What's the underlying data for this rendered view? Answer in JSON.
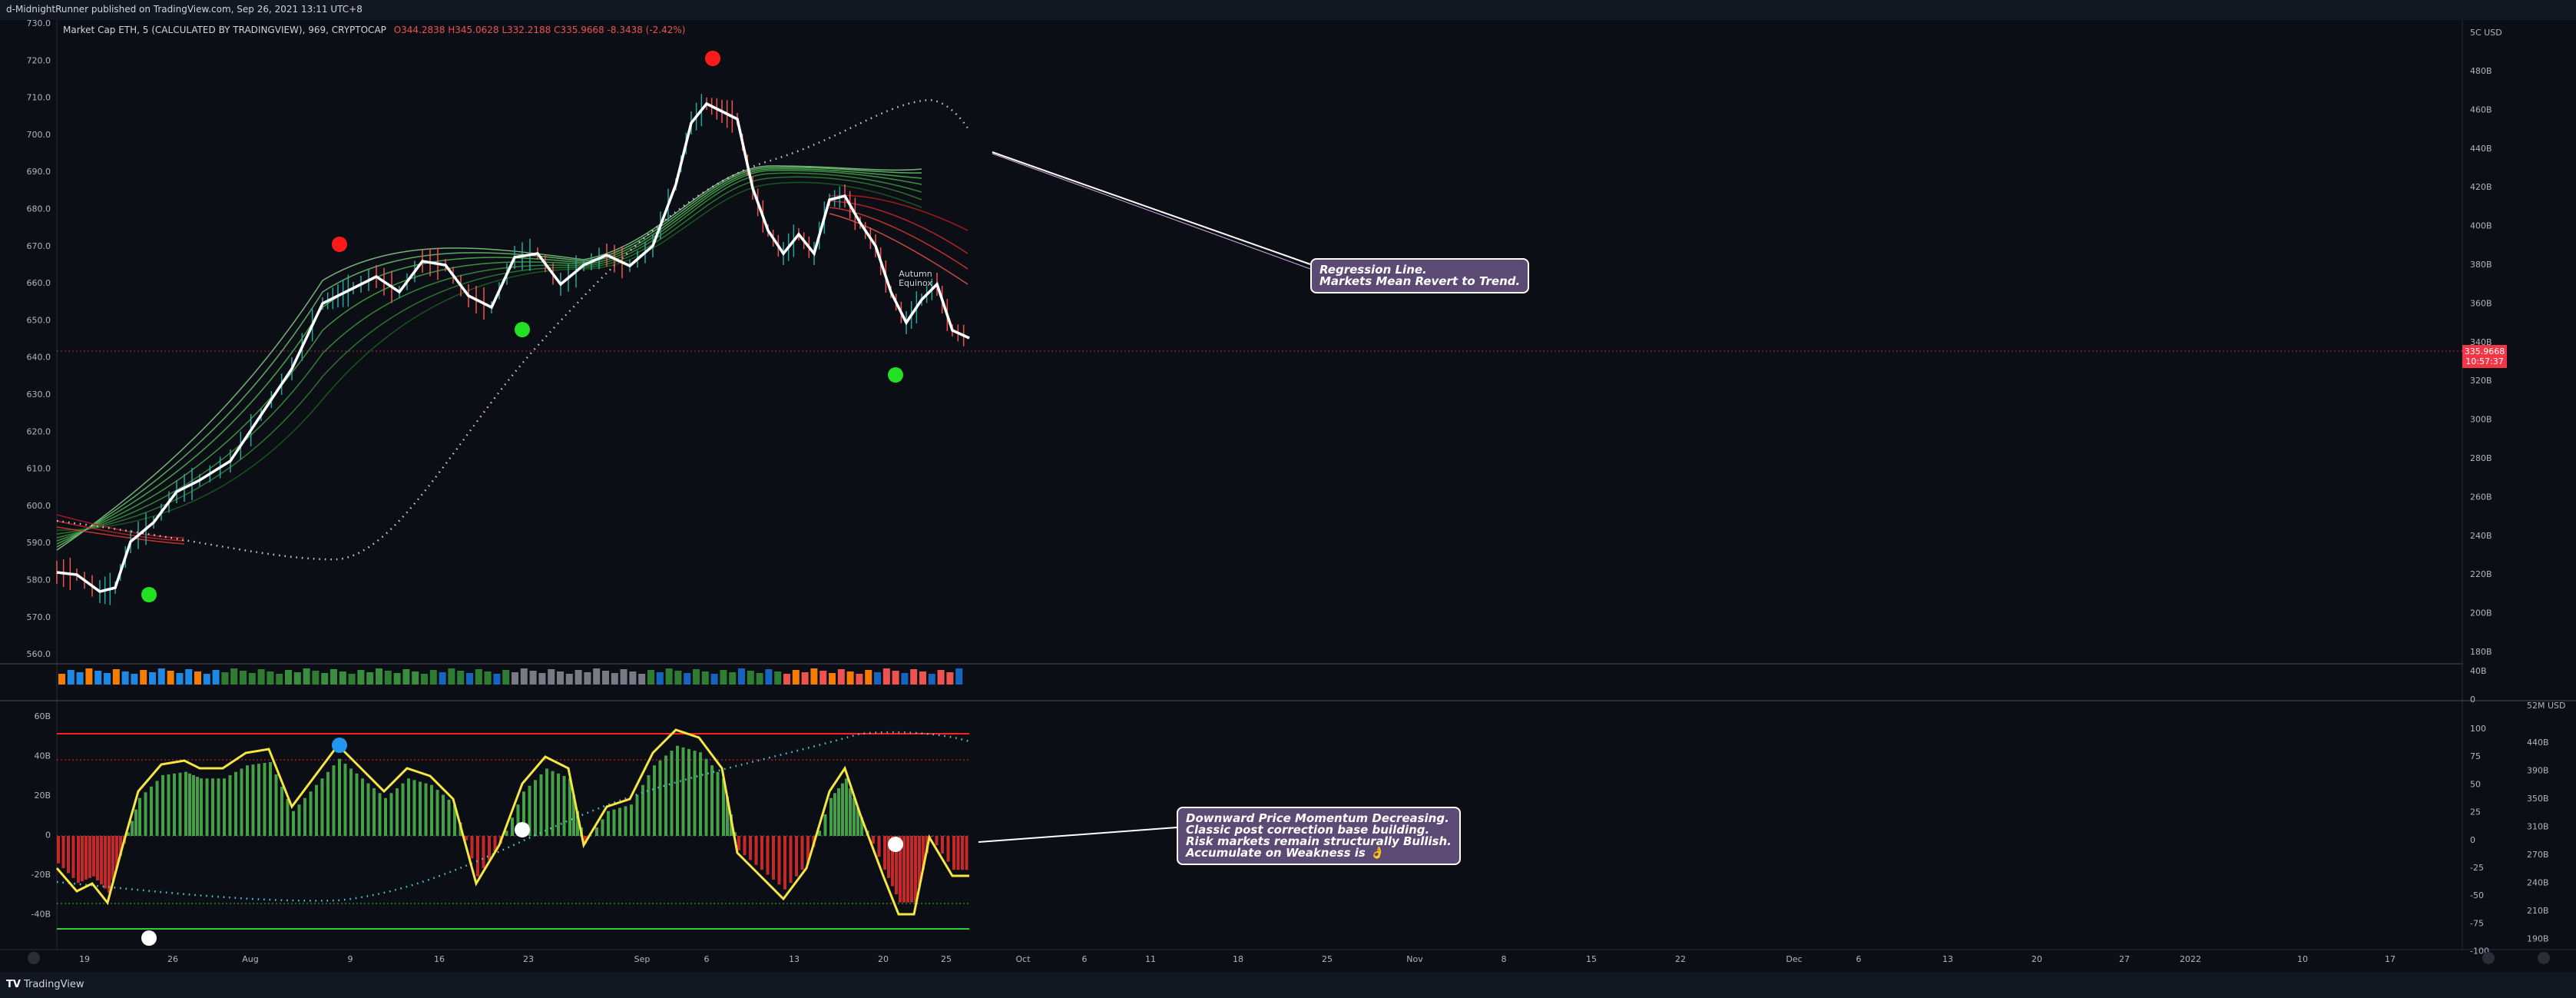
{
  "header": {
    "published": "d-MidnightRunner published on TradingView.com, Sep 26, 2021 13:11 UTC+8"
  },
  "legend": {
    "title": "Market Cap ETH, 5 (CALCULATED BY TRADINGVIEW), 969, CRYPTOCAP",
    "ohlc": "O344.2838 H345.0628 L332.2188 C335.9668 -8.3438 (-2.42%)"
  },
  "price_tag": {
    "price": "335.9668",
    "countdown": "10:57:37"
  },
  "annotations": {
    "regression": [
      "Regression Line.",
      "Markets Mean Revert to Trend."
    ],
    "momentum": [
      "Downward Price Momentum Decreasing.",
      "Classic post correction base building.",
      "Risk markets remain structurally Bullish.",
      "Accumulate on Weakness is 👌"
    ],
    "equinox": [
      "Autumn",
      "Equinox"
    ]
  },
  "axes": {
    "left_price": [
      "730.0",
      "720.0",
      "710.0",
      "700.0",
      "690.0",
      "680.0",
      "670.0",
      "660.0",
      "650.0",
      "640.0",
      "630.0",
      "620.0",
      "610.0",
      "600.0",
      "590.0",
      "580.0",
      "570.0",
      "560.0"
    ],
    "right_cap": [
      "480B",
      "460B",
      "440B",
      "420B",
      "400B",
      "380B",
      "360B",
      "340B",
      "320B",
      "300B",
      "280B",
      "260B",
      "240B",
      "220B",
      "200B",
      "180B"
    ],
    "right_top": "5C USD",
    "volume_right": [
      "40B",
      "0"
    ],
    "osc_left": [
      "60B",
      "40B",
      "20B",
      "0",
      "-20B",
      "-40B"
    ],
    "osc_right_pct": [
      "100",
      "75",
      "50",
      "25",
      "0",
      "-25",
      "-50",
      "-75",
      "-100"
    ],
    "osc_right_cap": [
      "52M USD",
      "440B",
      "390B",
      "350B",
      "310B",
      "270B",
      "240B",
      "210B",
      "190B"
    ],
    "time": [
      "19",
      "26",
      "Aug",
      "9",
      "16",
      "23",
      "Sep",
      "6",
      "13",
      "20",
      "25",
      "Oct",
      "6",
      "11",
      "18",
      "25",
      "Nov",
      "8",
      "15",
      "22",
      "Dec",
      "6",
      "13",
      "20",
      "27",
      "2022",
      "10",
      "17"
    ]
  },
  "brand": {
    "logo_text": "TradingView"
  },
  "colors": {
    "bg": "#0c0e15",
    "up": "#26a69a",
    "down": "#ef5350",
    "accent_line": "#f5e642",
    "callout": "#5b4a73"
  }
}
